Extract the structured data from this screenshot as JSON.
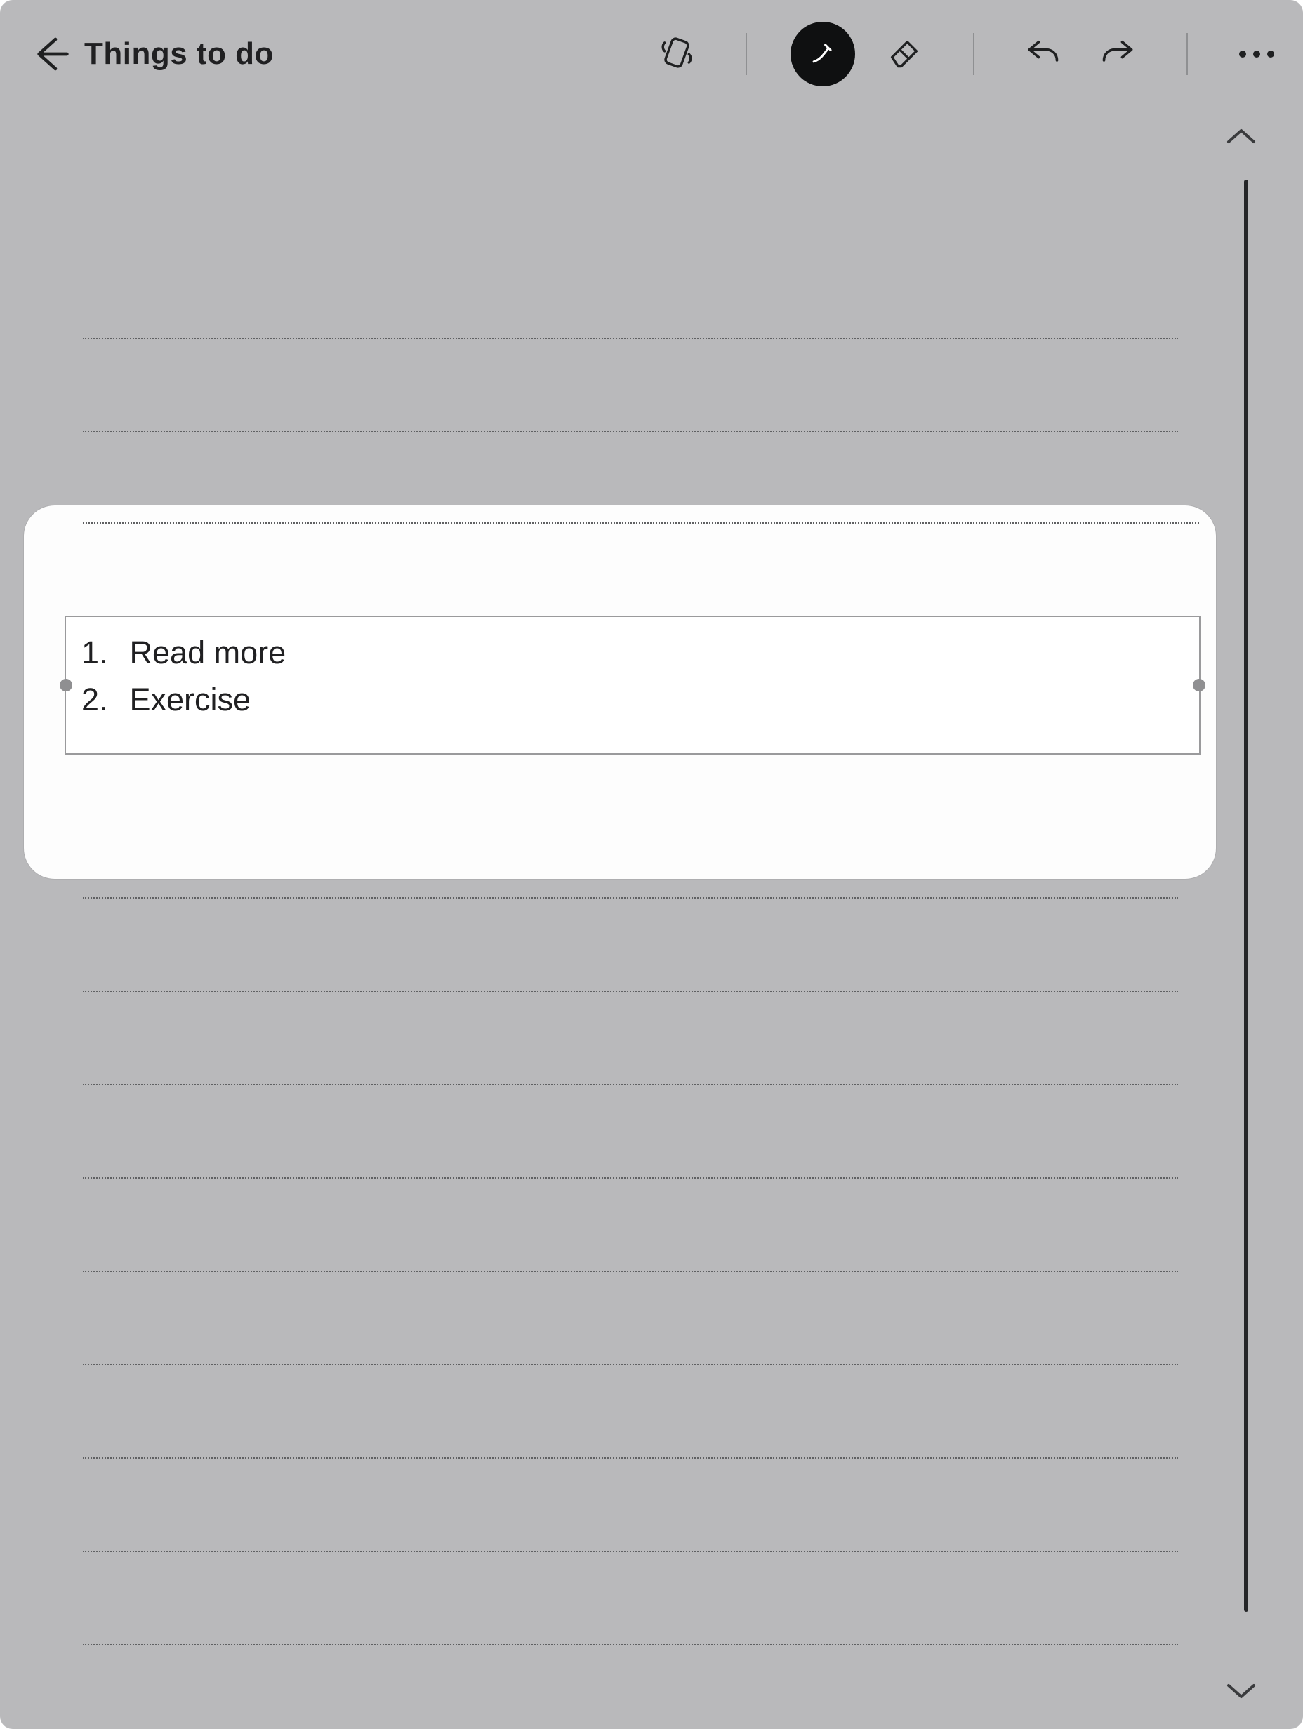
{
  "header": {
    "title": "Things to do"
  },
  "toolbar": {
    "icons": {
      "back": "back-arrow-icon",
      "rotate": "rotate-device-icon",
      "pen": "pen-icon",
      "eraser": "eraser-icon",
      "undo": "undo-icon",
      "redo": "redo-icon",
      "more": "more-options-icon"
    }
  },
  "text_block": {
    "items": [
      {
        "index": "1.",
        "label": "Read more"
      },
      {
        "index": "2.",
        "label": "Exercise"
      }
    ]
  }
}
